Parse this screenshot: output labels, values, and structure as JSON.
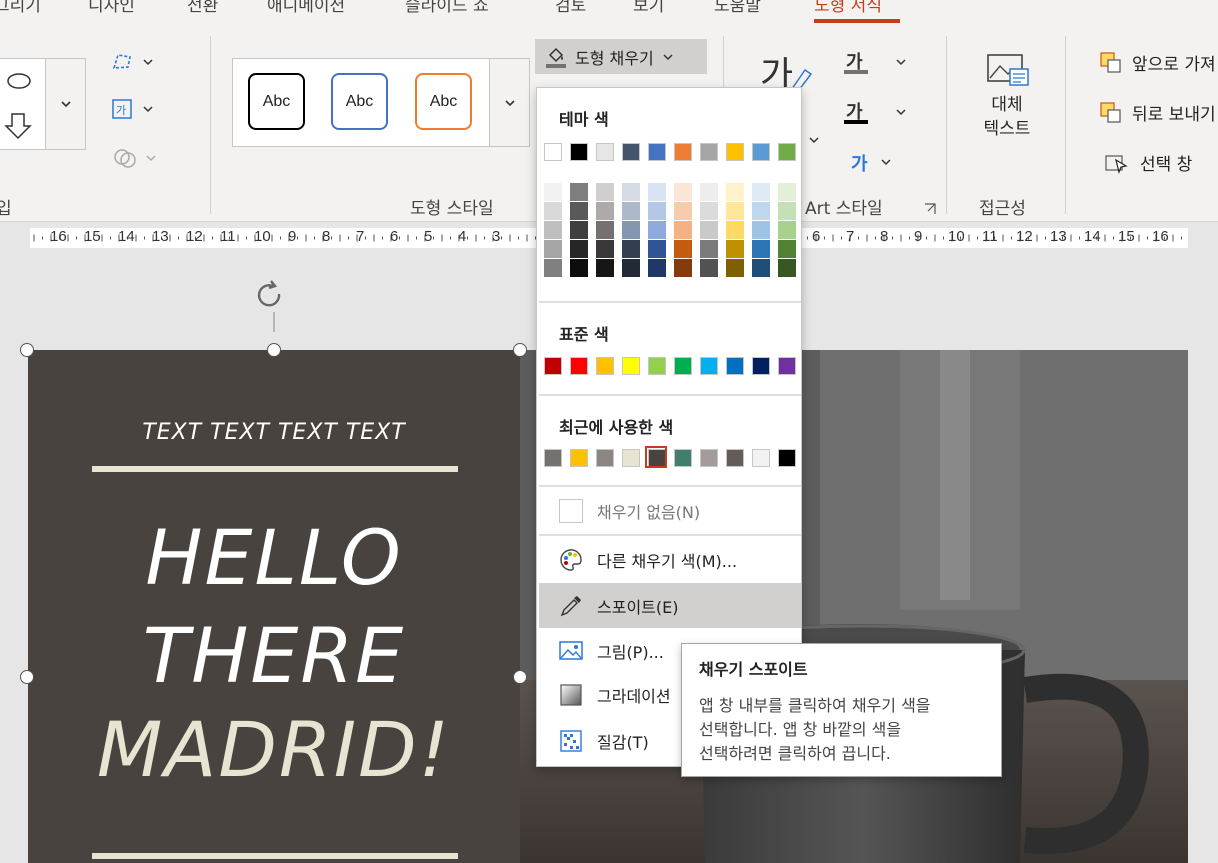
{
  "tabs": [
    "그리기",
    "디자인",
    "전환",
    "애니메이션",
    "슬라이드 쇼",
    "검토",
    "보기",
    "도움말",
    "도형 서식"
  ],
  "ribbon": {
    "groups": {
      "insert_shapes": "입",
      "shape_styles": "도형 스타일",
      "wordart_styles": "Art 스타일",
      "accessibility": "접근성"
    },
    "style_samples": [
      "Abc",
      "Abc",
      "Abc"
    ],
    "shape_fill": "도형 채우기",
    "alt_text": "대체\n텍스트",
    "arrange": {
      "bring_forward": "앞으로 가져",
      "send_backward": "뒤로 보내기",
      "selection_pane": "선택 창"
    },
    "wordart_glyph": "가"
  },
  "ruler": {
    "left": [
      "16",
      "15",
      "14",
      "13",
      "12",
      "11",
      "10",
      "9",
      "8",
      "7",
      "6",
      "5",
      "4",
      "3"
    ],
    "right": [
      "6",
      "7",
      "8",
      "9",
      "10",
      "11",
      "12",
      "13",
      "14",
      "15",
      "16"
    ]
  },
  "slide": {
    "small_text": "TEXT TEXT TEXT TEXT",
    "line1": "HELLO",
    "line2": "THERE",
    "line3": "MADRID!"
  },
  "dropdown": {
    "theme_heading": "테마 색",
    "theme_top": [
      "#ffffff",
      "#000000",
      "#e7e6e6",
      "#44546a",
      "#4472c4",
      "#ed7d31",
      "#a5a5a5",
      "#ffc000",
      "#5b9bd5",
      "#70ad47"
    ],
    "theme_shades": [
      [
        "#f2f2f2",
        "#7f7f7f",
        "#d0cece",
        "#d6dce4",
        "#dae3f3",
        "#fbe5d6",
        "#ededed",
        "#fff2cc",
        "#deebf7",
        "#e2f0d9"
      ],
      [
        "#d9d9d9",
        "#595959",
        "#aeaaaa",
        "#adb9ca",
        "#b4c7e7",
        "#f8cbad",
        "#dbdbdb",
        "#ffe699",
        "#bdd7ee",
        "#c5e0b4"
      ],
      [
        "#bfbfbf",
        "#3f3f3f",
        "#757171",
        "#8497b0",
        "#8faadc",
        "#f4b183",
        "#c9c9c9",
        "#ffd966",
        "#9dc3e6",
        "#a9d18e"
      ],
      [
        "#a6a6a6",
        "#262626",
        "#3a3838",
        "#333f50",
        "#2f5597",
        "#c55a11",
        "#7b7b7b",
        "#bf9000",
        "#2e75b6",
        "#548235"
      ],
      [
        "#808080",
        "#0d0d0d",
        "#171616",
        "#222a35",
        "#203864",
        "#843c0c",
        "#525252",
        "#7f6000",
        "#1f4e79",
        "#385723"
      ]
    ],
    "standard_heading": "표준 색",
    "standard": [
      "#c00000",
      "#ff0000",
      "#ffc000",
      "#ffff00",
      "#92d050",
      "#00b050",
      "#00b0f0",
      "#0070c0",
      "#002060",
      "#7030a0"
    ],
    "recent_heading": "최근에 사용한 색",
    "recent": [
      "#757171",
      "#ffc000",
      "#8c8584",
      "#e8e4d2",
      "#48433f",
      "#3f7f6b",
      "#a39c9b",
      "#655b5a",
      "#f2f2f2",
      "#000000"
    ],
    "no_fill": "채우기 없음(N)",
    "more_colors": "다른 채우기 색(M)...",
    "eyedropper": "스포이트(E)",
    "picture": "그림(P)...",
    "gradient": "그라데이션",
    "texture": "질감(T)"
  },
  "tooltip": {
    "title": "채우기 스포이트",
    "line1": "앱 창 내부를 클릭하여 채우기 색을",
    "line2": "선택합니다. 앱 창 바깥의 색을",
    "line3": "선택하려면 클릭하여 끕니다."
  }
}
